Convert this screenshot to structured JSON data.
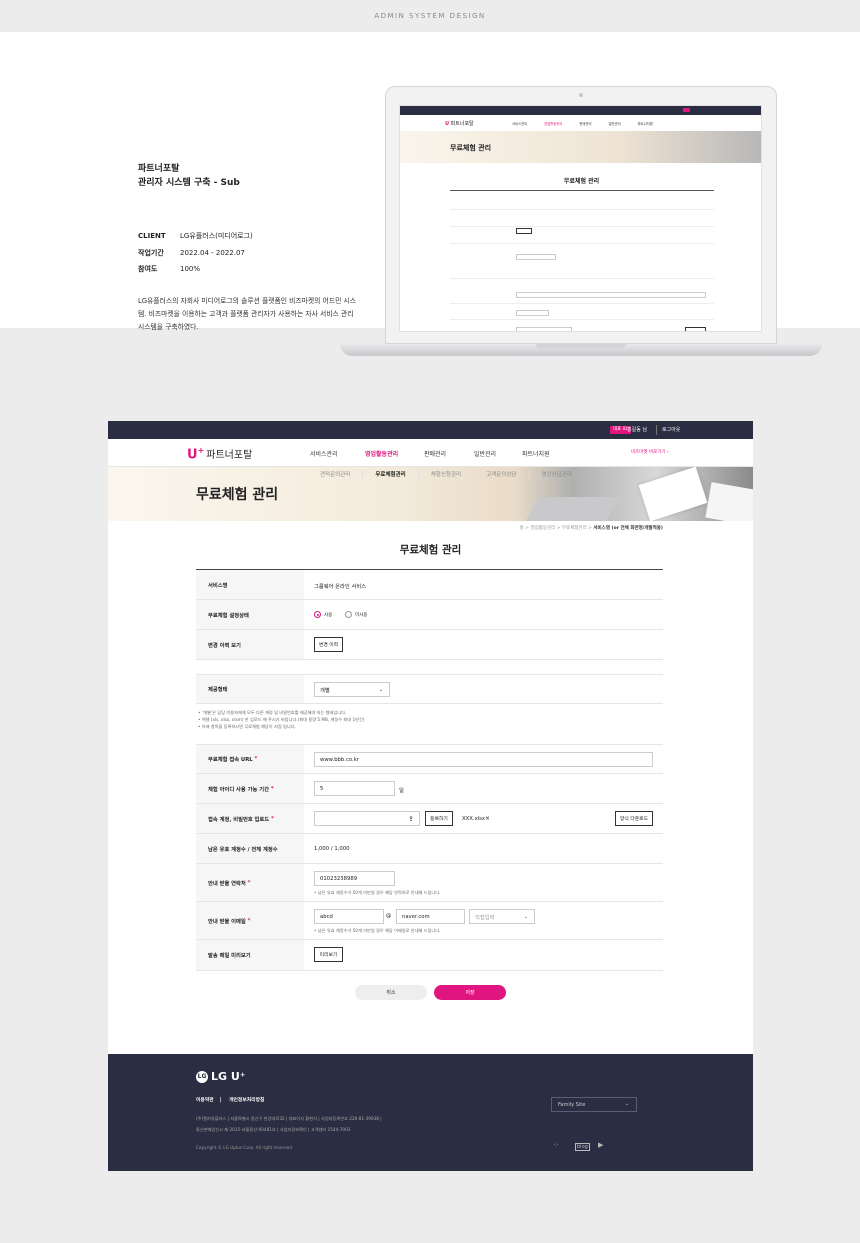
{
  "header": {
    "label": "ADMIN SYSTEM DESIGN"
  },
  "project": {
    "title_line1": "파트너포탈",
    "title_line2": "관리자 시스템 구축 - Sub",
    "meta": [
      {
        "key": "CLIENT",
        "value": "LG유플러스(미디어로그)"
      },
      {
        "key": "작업기간",
        "value": "2022.04 - 2022.07"
      },
      {
        "key": "참여도",
        "value": "100%"
      }
    ],
    "description": "LG유플러스의 자회사 미디어로그의 솔루션 플랫폼인 비즈마켓의 어드민 시스템. 비즈마켓을 이용하는 고객과 플랫폼 관리자가 사용하는 자사 서비스 관리 시스템을 구축하였다."
  },
  "mini": {
    "nav": [
      "서비스관리",
      "영업활동관리",
      "판매관리",
      "일반관리",
      "파트너지원"
    ],
    "banner_title": "무료체험 관리",
    "page_title": "무료체험 관리"
  },
  "app": {
    "top": {
      "badge": "대표 ID",
      "user": "홍길동 님",
      "logout": "로그아웃"
    },
    "logo_text": "파트너포탈",
    "logo_mark": "U",
    "nav": [
      "서비스관리",
      "영업활동관리",
      "판매관리",
      "일반관리",
      "파트너지원"
    ],
    "nav_active_index": 1,
    "biz_link": "비즈마켓 바로가기",
    "subnav": [
      "견적문의관리",
      "무료체험관리",
      "체험신청관리",
      "고객문의상담",
      "영상상담관리"
    ],
    "banner_title": "무료체험 관리",
    "breadcrumb_prefix": "홈 > 영업활동관리 > 무료체험관리 >",
    "breadcrumb_current": "서비스명 (or 전체 화면명/개발적용)",
    "page_title": "무료체험 관리",
    "form": {
      "service_name_label": "서비스명",
      "service_name_value": "그룹웨어 온라인 서비스",
      "status_label": "무료체험 설정상태",
      "status_options": [
        "사용",
        "미사용"
      ],
      "history_label": "변경 이력 보기",
      "history_button": "변경 이력",
      "type_label": "제공형태",
      "type_value": "개별",
      "notes": [
        "‘개별’은 담당 미용자에게 모두 다른 계정 및 비밀번호를 제공해야 하는 형태입니다.",
        "엑셀 (xls, xlsx, xlsm) 만 업로드 해 주시기 바랍니다.(최대 용량 5 MB, 계정수 최대 1만건)",
        "아래 항목을 등록하시면 무료체험 해당이 지정 됩니다."
      ],
      "url_label": "무료체험 접속 URL",
      "url_value": "www.bbb.co.kr",
      "period_label": "체험 아이디 사용 가능 기간",
      "period_value": "5",
      "period_unit": "일",
      "upload_label": "접속 계정, 비밀번호 업로드",
      "upload_button": "등록하기",
      "upload_file": "XXX.xlsx",
      "template_button": "양식 다운로드",
      "remaining_label": "남은 유효 계정수 / 전체 계정수",
      "remaining_value": "1,000 / 1,000",
      "contact_label": "안내 받을 연락처",
      "contact_value": "01023238989",
      "contact_note": "남은 유효 계정수가 50개 미만일 경우 해당 연락처로 안내해 드립니다.",
      "email_label": "안내 받을 이메일",
      "email_id": "abcd",
      "email_at": "@",
      "email_domain": "naver.com",
      "email_select": "직접입력",
      "email_note": "남은 유효 계정수가 50개 미만일 경우 해당 이메일로 안내해 드립니다.",
      "preview_label": "발송 메일 미리보기",
      "preview_button": "미리보기"
    },
    "actions": {
      "cancel": "취소",
      "save": "저장"
    },
    "footer": {
      "logo": "LG U⁺",
      "links": [
        "이용약관",
        "개인정보처리방침"
      ],
      "address1": "(주)엘지유플러스  |  서울특별시 용산구 한강대로32  |  대표이사 황현식  |  사업자등록번호 220-81-39938  |",
      "address2": "통신판매업신고 제 2015-서울용산-00481호  |  사업자정보확인  |  고객센터 1544-7003",
      "copyright": "Copyright © LG Uplus Corp. All right reserved.",
      "family_site": "Family Site",
      "sns": [
        "t-icon",
        "blog-icon",
        "youtube-icon"
      ]
    }
  },
  "colors": {
    "accent": "#e0157f",
    "dark": "#2b2d42"
  }
}
